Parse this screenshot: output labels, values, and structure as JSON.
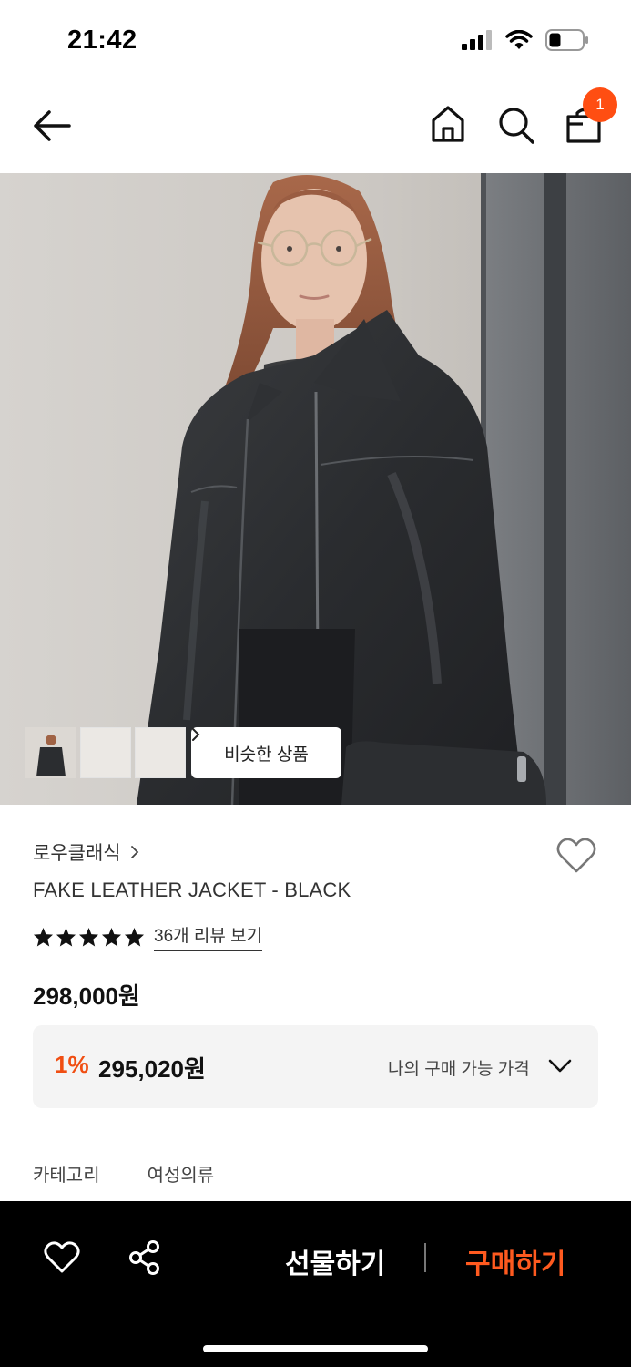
{
  "status_bar": {
    "time": "21:42",
    "icons": [
      "signal-icon",
      "wifi-icon",
      "battery-icon"
    ]
  },
  "header": {
    "icons": [
      "back-arrow-icon",
      "home-icon",
      "search-icon",
      "shopping-bag-icon"
    ],
    "cart_count": "1"
  },
  "gallery": {
    "thumbnail_count": 3,
    "similar_products_label": "비슷한 상품"
  },
  "product": {
    "brand": "로우클래식",
    "name": "FAKE LEATHER JACKET - BLACK",
    "rating_stars": 5,
    "review_link": "36개 리뷰 보기",
    "price": "298,000원"
  },
  "price_box": {
    "discount_rate": "1%",
    "discount_price": "295,020원",
    "my_price_label": "나의 구매 가능 가격"
  },
  "meta": {
    "category_label": "카테고리",
    "category_value": "여성의류"
  },
  "bottom_bar": {
    "gift_label": "선물하기",
    "buy_label": "구매하기"
  },
  "colors": {
    "accent": "#ff5a1f",
    "badge": "#ff4e12",
    "bottom_bar_bg": "#000000"
  }
}
